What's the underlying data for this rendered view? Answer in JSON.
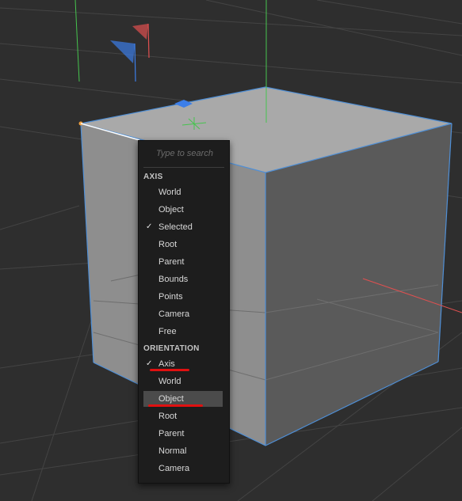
{
  "menu": {
    "search_placeholder": "Type to search",
    "sections": [
      {
        "title": "AXIS",
        "items": [
          {
            "label": "World",
            "checked": false
          },
          {
            "label": "Object",
            "checked": false
          },
          {
            "label": "Selected",
            "checked": true
          },
          {
            "label": "Root",
            "checked": false
          },
          {
            "label": "Parent",
            "checked": false
          },
          {
            "label": "Bounds",
            "checked": false
          },
          {
            "label": "Points",
            "checked": false
          },
          {
            "label": "Camera",
            "checked": false
          },
          {
            "label": "Free",
            "checked": false
          }
        ]
      },
      {
        "title": "ORIENTATION",
        "items": [
          {
            "label": "Axis",
            "checked": true
          },
          {
            "label": "World",
            "checked": false
          },
          {
            "label": "Object",
            "checked": false,
            "highlighted": true
          },
          {
            "label": "Root",
            "checked": false
          },
          {
            "label": "Parent",
            "checked": false
          },
          {
            "label": "Normal",
            "checked": false
          },
          {
            "label": "Camera",
            "checked": false
          }
        ]
      }
    ],
    "check_icon": "✓"
  },
  "colors": {
    "background": "#2e2e2e",
    "grid": "#444444",
    "cube_top": "#a8a8a8",
    "cube_left": "#8f8f8f",
    "cube_right": "#5b5b5b",
    "edge": "#4f8fd6",
    "axis_x": "#e05050",
    "axis_y": "#46c44e",
    "axis_z": "#3c7ee8",
    "menu_bg": "#1d1d1d",
    "highlight": "#4b4b4b",
    "annotation": "#e01010"
  }
}
